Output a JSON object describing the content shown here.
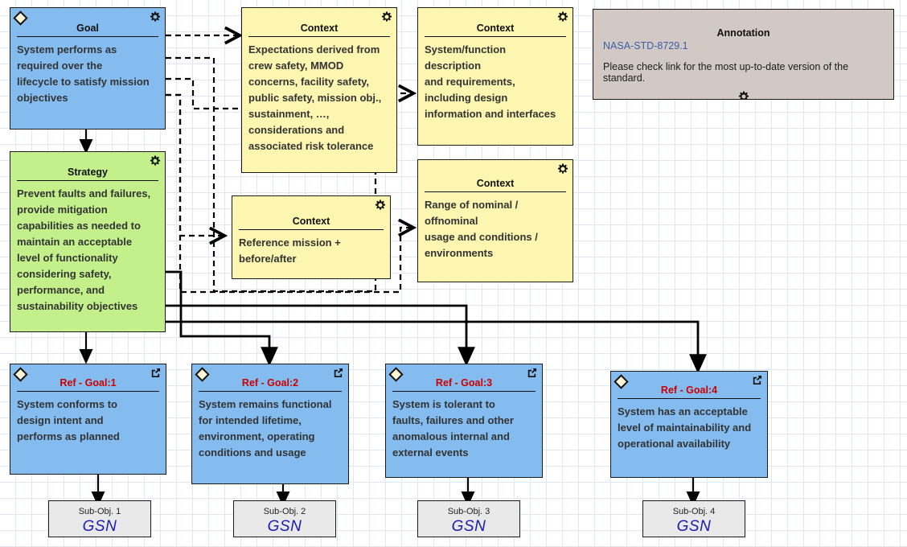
{
  "diagram": {
    "title": "GSN Assurance Case",
    "grid": {
      "spacing": 20,
      "color": "#dce9f5"
    },
    "colors": {
      "goal": "#84bcf0",
      "strategy": "#c3f08a",
      "context": "#fcf6b0",
      "annotation": "#d2c9c4",
      "subobjective": "#e9e9e9",
      "ref_title": "#cc0000",
      "gsn_text": "#1a1ab0",
      "link_text": "#3b5ea8",
      "connector": "#000000"
    }
  },
  "nodes": {
    "goal": {
      "type": "Goal",
      "title": "Goal",
      "body": "System performs as\nrequired over the\nlifecycle to satisfy mission\nobjectives",
      "icons": [
        "diamond-icon",
        "gear-icon"
      ]
    },
    "strategy": {
      "type": "Strategy",
      "title": "Strategy",
      "body": "Prevent faults and failures,\nprovide mitigation\ncapabilities as needed to\nmaintain an acceptable\nlevel of functionality\nconsidering safety,\nperformance, and\nsustainability objectives",
      "icons": [
        "gear-icon"
      ]
    },
    "context_expectations": {
      "type": "Context",
      "title": "Context",
      "body": "Expectations derived from\ncrew safety, MMOD\nconcerns, facility safety,\npublic safety, mission obj.,\nsustainment, …,\nconsiderations and\nassociated risk tolerance",
      "icons": [
        "gear-icon"
      ]
    },
    "context_system": {
      "type": "Context",
      "title": "Context",
      "body": "System/function\ndescription\nand requirements,\nincluding design\ninformation and interfaces",
      "icons": [
        "gear-icon"
      ]
    },
    "context_reference_mission": {
      "type": "Context",
      "title": "Context",
      "body": "Reference mission +\nbefore/after",
      "icons": [
        "gear-icon"
      ]
    },
    "context_range": {
      "type": "Context",
      "title": "Context",
      "body": "Range of nominal /\noffnominal\nusage and conditions /\nenvironments",
      "icons": [
        "gear-icon"
      ]
    },
    "annotation": {
      "type": "Annotation",
      "title": "Annotation",
      "link_text": "NASA-STD-8729.1",
      "text": "Please check link for the most up-to-date version of the standard.",
      "icons": [
        "gear-icon"
      ]
    }
  },
  "ref_goals": [
    {
      "title": "Ref - Goal:1",
      "body": "System conforms to\ndesign intent and\nperforms as planned",
      "icons": [
        "diamond-icon",
        "external-link-icon"
      ]
    },
    {
      "title": "Ref - Goal:2",
      "body": "System remains functional\nfor intended lifetime,\nenvironment, operating\nconditions and usage",
      "icons": [
        "diamond-icon",
        "external-link-icon"
      ]
    },
    {
      "title": "Ref - Goal:3",
      "body": "System is tolerant to\nfaults, failures and other\nanomalous internal and\nexternal events",
      "icons": [
        "diamond-icon",
        "external-link-icon"
      ]
    },
    {
      "title": "Ref - Goal:4",
      "body": "System has an acceptable\nlevel of maintainability and\noperational availability",
      "icons": [
        "diamond-icon",
        "external-link-icon"
      ]
    }
  ],
  "sub_objectives": [
    {
      "label": "Sub-Obj. 1",
      "value": "GSN"
    },
    {
      "label": "Sub-Obj. 2",
      "value": "GSN"
    },
    {
      "label": "Sub-Obj. 3",
      "value": "GSN"
    },
    {
      "label": "Sub-Obj. 4",
      "value": "GSN"
    }
  ]
}
